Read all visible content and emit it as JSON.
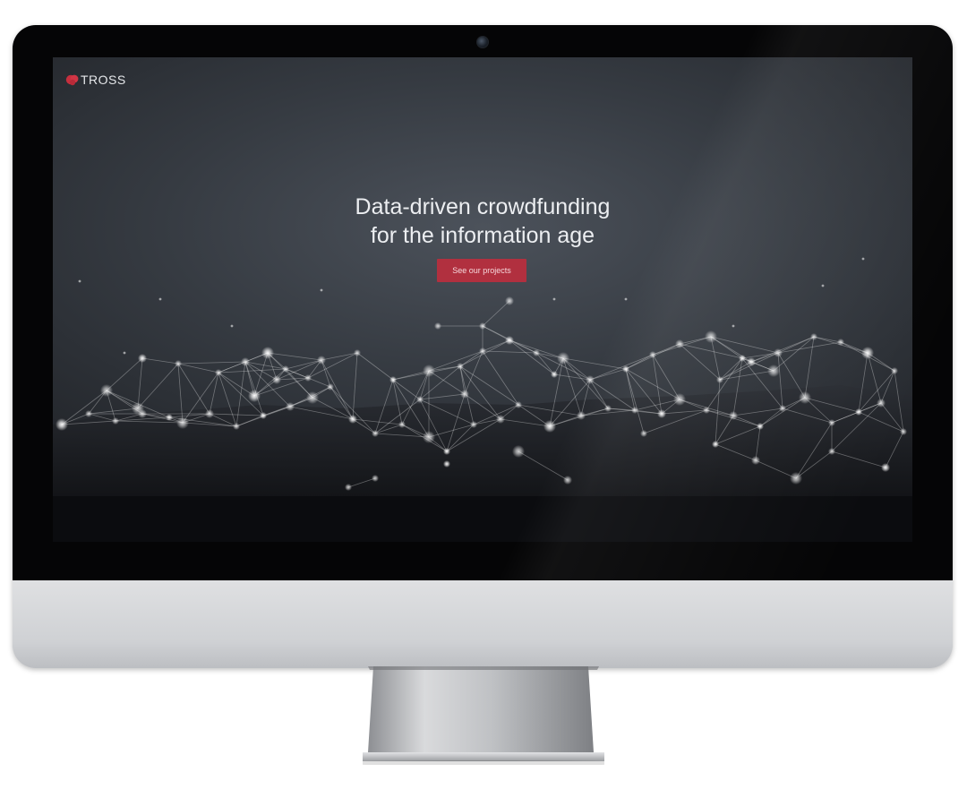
{
  "website": {
    "logo": {
      "text": "TROSS",
      "icon": "brain-icon",
      "accent_color": "#c62f3e"
    },
    "hero": {
      "title_line_1": "Data-driven crowdfunding",
      "title_line_2": "for the information age"
    },
    "cta": {
      "label": "See our projects",
      "background_color": "#b1303f"
    }
  },
  "device": {
    "type": "desktop-monitor",
    "camera_icon": "webcam-icon"
  }
}
